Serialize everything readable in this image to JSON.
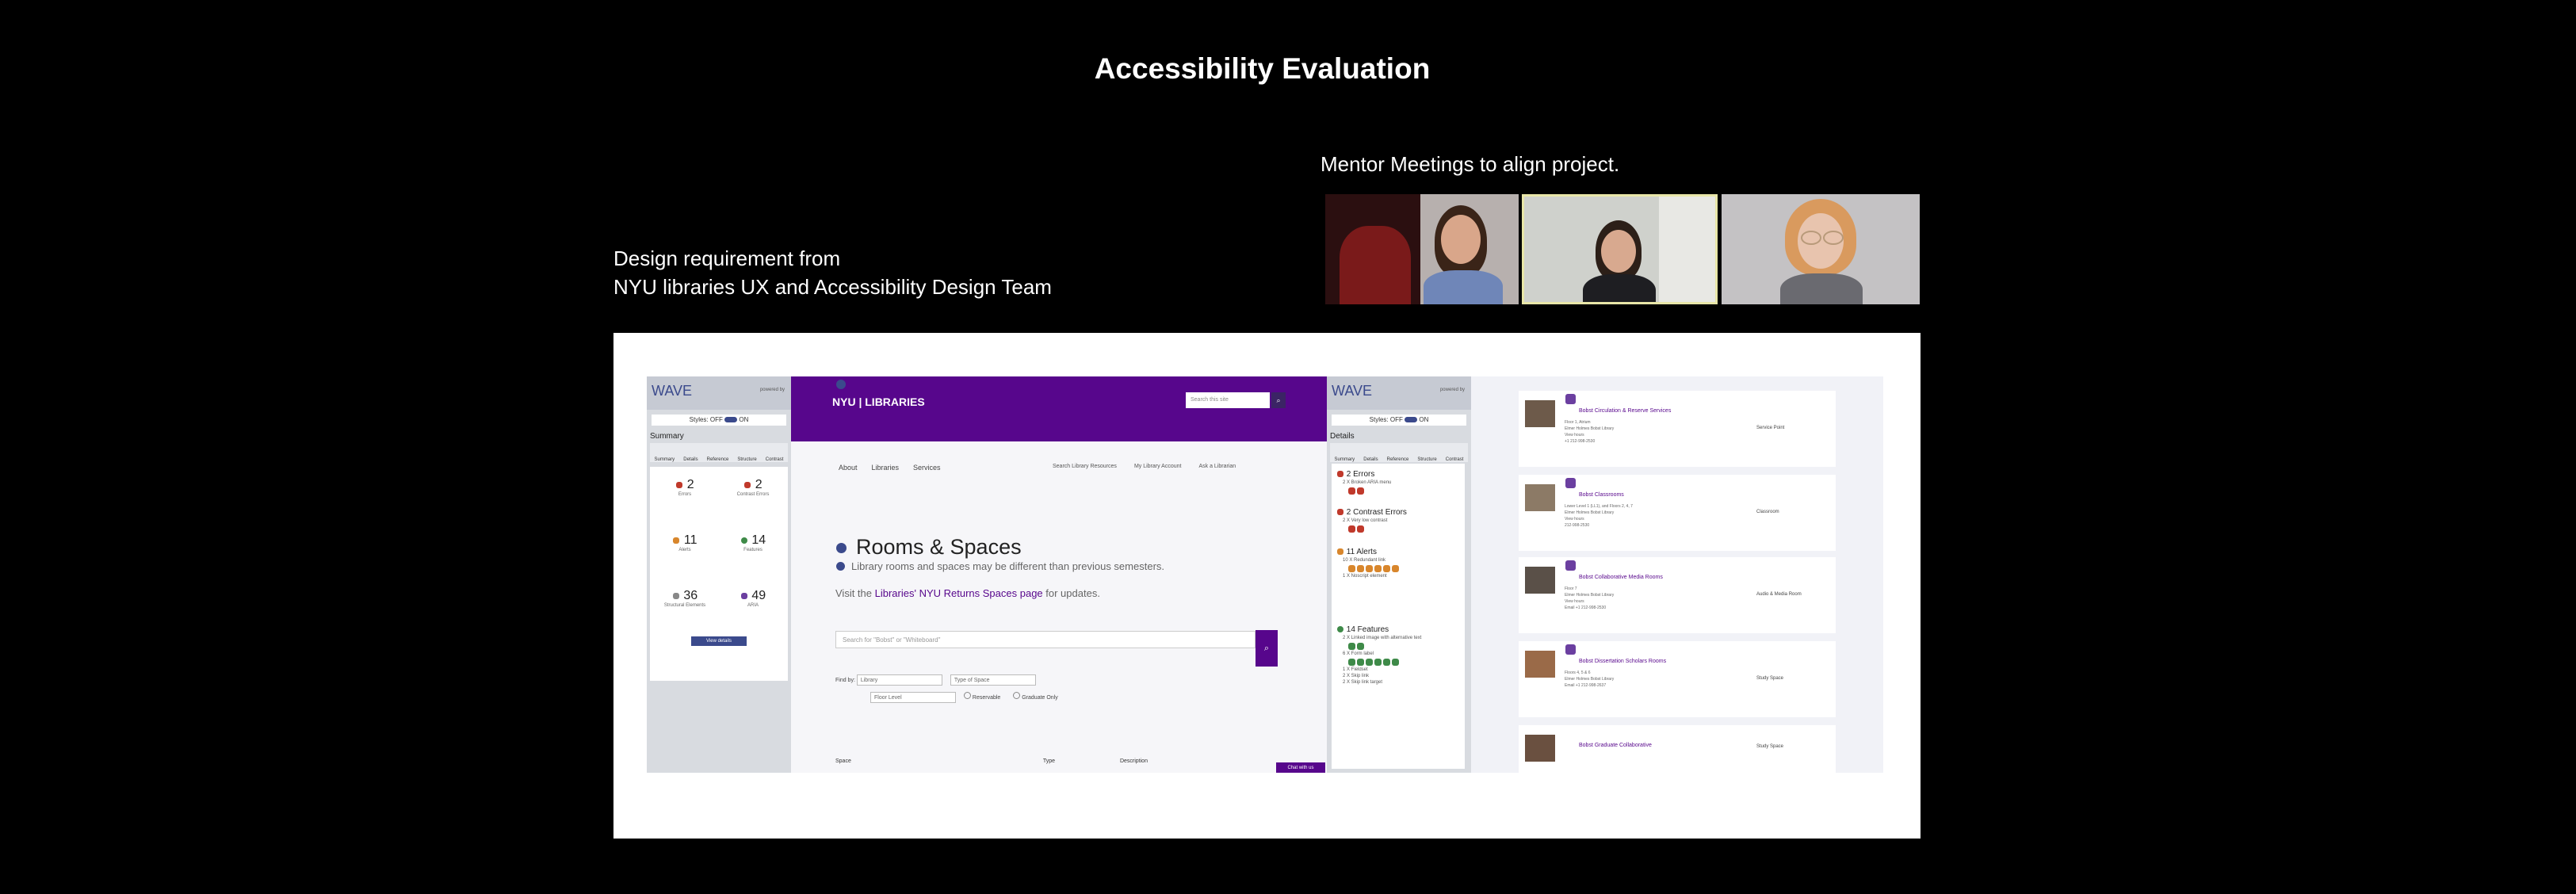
{
  "title": "Accessibility Evaluation",
  "design_requirement": {
    "line1": "Design requirement from",
    "line2": "NYU libraries UX and Accessibility Design Team"
  },
  "mentor_caption": "Mentor Meetings to align project.",
  "colors": {
    "background": "#000000",
    "nyu_purple": "#57068c",
    "wave_blue": "#3b4a8c",
    "wave_error": "#c0392b",
    "wave_alert": "#d8862c",
    "wave_feature": "#3e8a48",
    "active_speaker_border": "#e8e6a8"
  },
  "wave_summary": {
    "logo": "WAVE",
    "powered_by": "powered by",
    "styles_label": "Styles:",
    "styles_off": "OFF",
    "styles_on": "ON",
    "panel_title": "Summary",
    "tabs": [
      "Summary",
      "Details",
      "Reference",
      "Structure",
      "Contrast"
    ],
    "stats": [
      {
        "count": "2",
        "label": "Errors",
        "icon": "error-icon"
      },
      {
        "count": "2",
        "label": "Contrast Errors",
        "icon": "contrast-icon"
      },
      {
        "count": "11",
        "label": "Alerts",
        "icon": "alert-icon"
      },
      {
        "count": "14",
        "label": "Features",
        "icon": "feature-icon"
      },
      {
        "count": "36",
        "label": "Structural Elements",
        "icon": "structure-icon"
      },
      {
        "count": "49",
        "label": "ARIA",
        "icon": "aria-icon"
      }
    ],
    "view_details": "View details"
  },
  "nyu_page": {
    "logo": "NYU | LIBRARIES",
    "search_placeholder": "Search this site",
    "nav": [
      "About",
      "Libraries",
      "Services"
    ],
    "nav_right": [
      "Search Library Resources",
      "My Library Account",
      "Ask a Librarian"
    ],
    "heading": "Rooms & Spaces",
    "subheading": "Library rooms and spaces may be different than previous semesters.",
    "visit_prefix": "Visit the ",
    "visit_link": "Libraries' NYU Returns Spaces page",
    "visit_suffix": " for updates.",
    "search_input_placeholder": "Search for \"Bobst\" or \"Whiteboard\"",
    "find_by": "Find by:",
    "filter_library": "Library",
    "filter_type": "Type of Space",
    "filter_floor": "Floor Level",
    "reservable": "Reservable",
    "graduate_only": "Graduate Only",
    "col_space": "Space",
    "col_type": "Type",
    "col_description": "Description",
    "chat": "Chat with us"
  },
  "wave_details": {
    "logo": "WAVE",
    "powered_by": "powered by",
    "styles_label": "Styles:",
    "styles_off": "OFF",
    "styles_on": "ON",
    "panel_title": "Details",
    "tabs": [
      "Summary",
      "Details",
      "Reference",
      "Structure",
      "Contrast"
    ],
    "errors_title": "2 Errors",
    "errors_item": "2 X Broken ARIA menu",
    "contrast_title": "2 Contrast Errors",
    "contrast_item": "2 X Very low contrast",
    "alerts_title": "11 Alerts",
    "alerts_item1": "10 X Redundant link",
    "alerts_item2": "1 X Noscript element",
    "features_title": "14 Features",
    "features_item1": "2 X Linked image with alternative text",
    "features_item2": "6 X Form label",
    "features_item3": "1 X Fieldset",
    "features_item4": "2 X Skip link",
    "features_item5": "2 X Skip link target"
  },
  "results": [
    {
      "title": "Bobst Circulation & Reserve Services",
      "line1": "Floor 1, Atrium",
      "line2": "Elmer Holmes Bobst Library",
      "line3": "View hours",
      "line4": "+1 212-998-2530",
      "type": "Service Point"
    },
    {
      "title": "Bobst Classrooms",
      "line1": "Lower Level 1 (LL1), and Floors 2, 4, 7",
      "line2": "Elmer Holmes Bobst Library",
      "line3": "View hours",
      "line4": "212-998-2530",
      "type": "Classroom"
    },
    {
      "title": "Bobst Collaborative Media Rooms",
      "line1": "Floor 7",
      "line2": "Elmer Holmes Bobst Library",
      "line3": "View hours",
      "line4": "Email  +1 212-998-2530",
      "type": "Audio & Media Room"
    },
    {
      "title": "Bobst Dissertation Scholars Rooms",
      "line1": "Floors 4, 5 & 6",
      "line2": "Elmer Holmes Bobst Library",
      "line3": "Email  +1 212-998-2637",
      "line4": "",
      "type": "Study Space"
    },
    {
      "title": "Bobst Graduate Collaborative",
      "line1": "",
      "line2": "",
      "line3": "",
      "line4": "",
      "type": "Study Space"
    }
  ]
}
